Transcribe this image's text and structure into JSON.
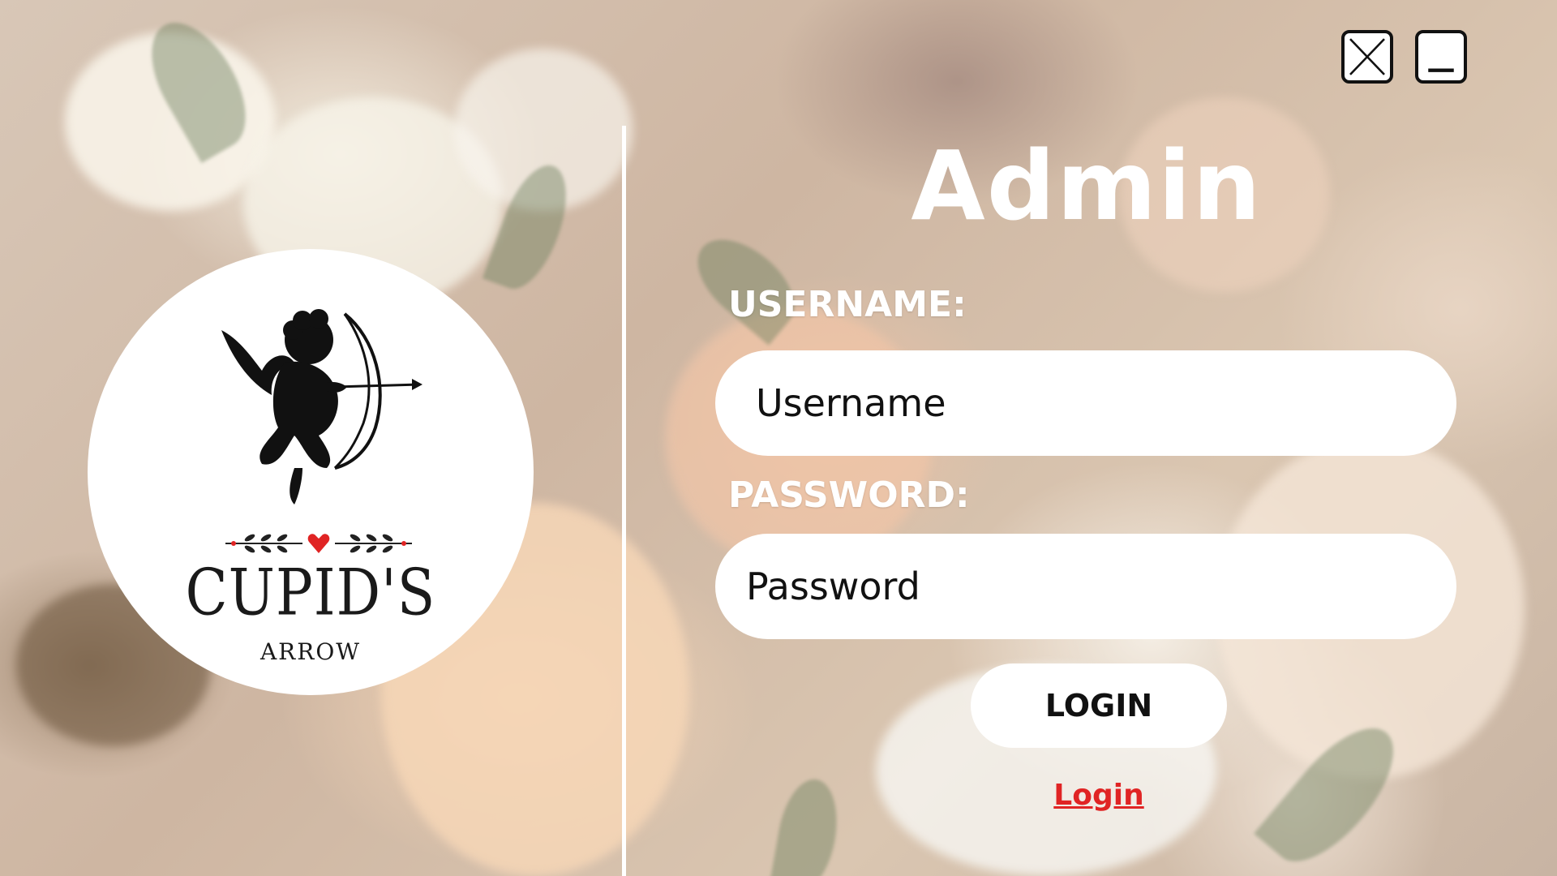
{
  "window_controls": {
    "close_icon": "close-x-icon",
    "minimize_icon": "minimize-icon"
  },
  "logo": {
    "icon": "cupid-archer-icon",
    "ornament": "heart-laurel-ornament",
    "brand_name": "CUPID'S",
    "brand_sub": "ARROW",
    "heart_color": "#e02424"
  },
  "form": {
    "title": "Admin",
    "username_label": "USERNAME:",
    "username_placeholder": "Username",
    "password_label": "PASSWORD:",
    "password_placeholder": "Password",
    "login_button": "LOGIN",
    "login_link": "Login"
  },
  "colors": {
    "text_white": "#ffffff",
    "link_red": "#e02424",
    "dark": "#111111"
  }
}
